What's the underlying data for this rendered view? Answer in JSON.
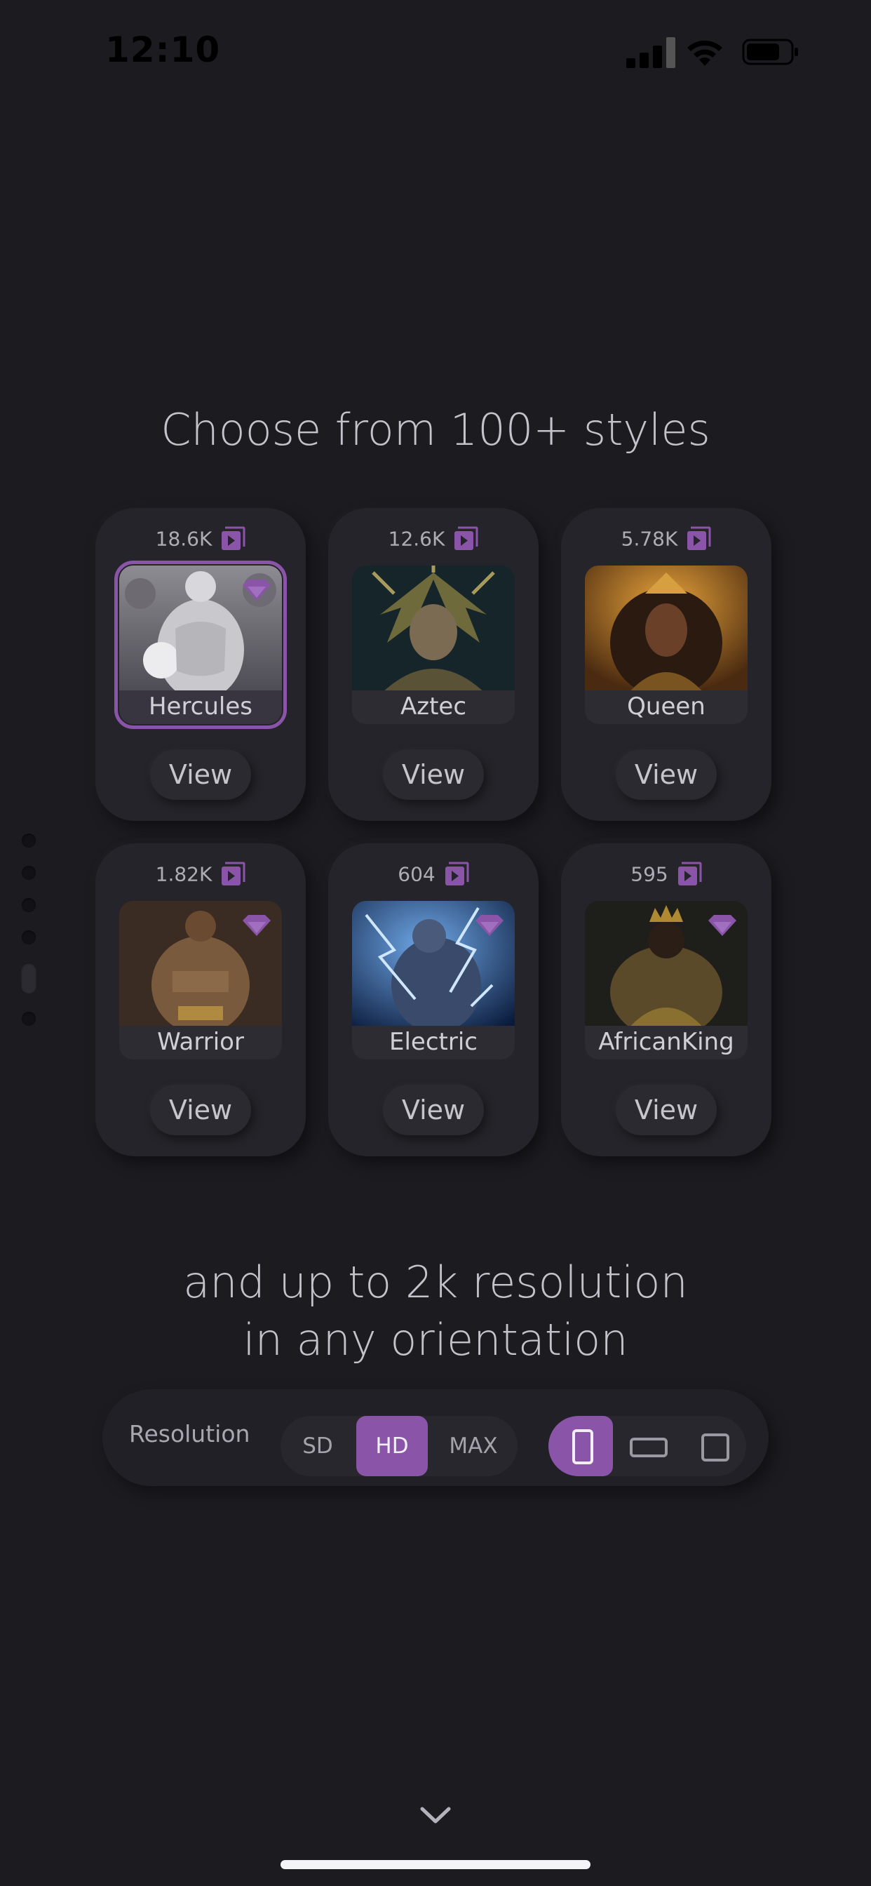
{
  "status_bar": {
    "time": "12:10"
  },
  "title": "Choose from 100+ styles",
  "styles": [
    {
      "count": "18.6K",
      "label": "Hercules",
      "view_label": "View",
      "premium": true,
      "selected": true
    },
    {
      "count": "12.6K",
      "label": "Aztec",
      "view_label": "View",
      "premium": false,
      "selected": false
    },
    {
      "count": "5.78K",
      "label": "Queen",
      "view_label": "View",
      "premium": false,
      "selected": false
    },
    {
      "count": "1.82K",
      "label": "Warrior",
      "view_label": "View",
      "premium": true,
      "selected": false
    },
    {
      "count": "604",
      "label": "Electric",
      "view_label": "View",
      "premium": true,
      "selected": false
    },
    {
      "count": "595",
      "label": "AfricanKing",
      "view_label": "View",
      "premium": true,
      "selected": false
    }
  ],
  "subtitle_line1": "and up to 2k resolution",
  "subtitle_line2": "in any orientation",
  "resolution": {
    "label": "Resolution",
    "options": [
      "SD",
      "HD",
      "MAX"
    ],
    "selected": "HD",
    "orientations": [
      "portrait",
      "landscape",
      "square"
    ],
    "selected_orientation": "portrait"
  },
  "colors": {
    "accent": "#8a55a8",
    "background": "#1c1b20",
    "card": "#25242a"
  }
}
